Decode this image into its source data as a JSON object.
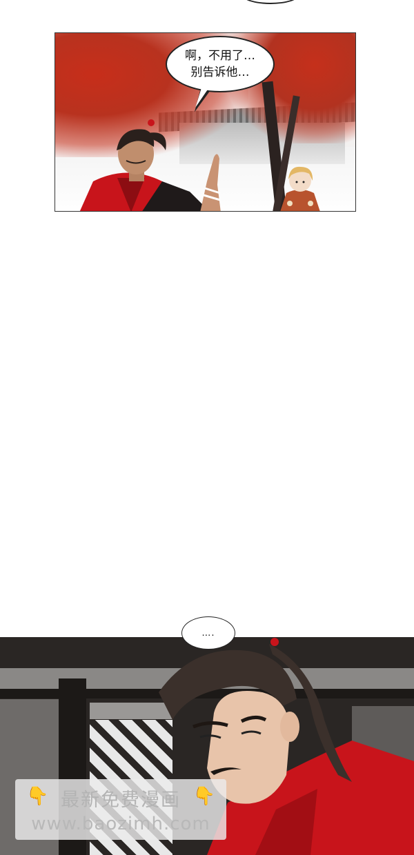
{
  "panel1": {
    "speech_line1": "啊，不用了…",
    "speech_line2": "别告诉他…"
  },
  "panel2": {
    "speech": "…."
  },
  "watermark": {
    "line1": "最新免费漫画",
    "line2": "www.baozimh.com",
    "icon": "pointing-down-hand-icon",
    "icon_color": "#f2a623"
  },
  "colors": {
    "robe_red": "#c8141b",
    "foliage_red": "#c72e1a"
  }
}
